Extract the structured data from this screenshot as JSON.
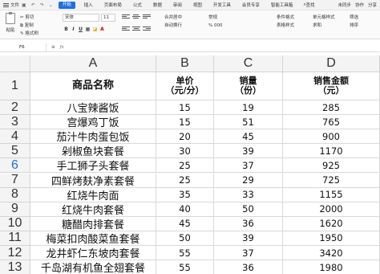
{
  "menubar": {
    "file": "文件",
    "tabs": [
      "开始",
      "插入",
      "页面布局",
      "公式",
      "数据",
      "审阅",
      "视图",
      "开发工具",
      "会员专享",
      "智能工具箱"
    ],
    "active_tab": 0,
    "search": "查找",
    "right_items": [
      "未同步",
      "协作",
      "分享"
    ]
  },
  "ribbon": {
    "paste": "粘贴",
    "cut": "剪切",
    "copy": "复制",
    "format_painter": "格式刷",
    "font": "宋体",
    "size": "11",
    "bold": "B",
    "italic": "I",
    "underline": "U",
    "wrap": "合并居中",
    "autowrap": "自动换行",
    "number_format": "常规",
    "percent": "% 000",
    "cond_fmt": "条件格式",
    "table_style": "表格样式",
    "cell_style": "单元格样式",
    "sum": "求和",
    "filter": "筛选",
    "sort": "排序"
  },
  "formula_bar": {
    "name_box": "F6",
    "fx": "fx",
    "value": ""
  },
  "sheet": {
    "columns": [
      "A",
      "B",
      "C",
      "D"
    ],
    "row_numbers": [
      "1",
      "2",
      "3",
      "4",
      "5",
      "6",
      "7",
      "8",
      "9",
      "10",
      "11",
      "12",
      "13"
    ],
    "selected_row": "6",
    "header_row": {
      "a": "商品名称",
      "b1": "单价",
      "b2": "（元/分）",
      "c1": "销量",
      "c2": "（份）",
      "d1": "销售金额",
      "d2": "（元）"
    },
    "rows": [
      {
        "name": "八宝辣酱饭",
        "price": "15",
        "qty": "19",
        "amount": "285"
      },
      {
        "name": "宫爆鸡丁饭",
        "price": "15",
        "qty": "51",
        "amount": "765"
      },
      {
        "name": "茄汁牛肉蛋包饭",
        "price": "20",
        "qty": "45",
        "amount": "900"
      },
      {
        "name": "剁椒鱼块套餐",
        "price": "30",
        "qty": "39",
        "amount": "1170"
      },
      {
        "name": "手工狮子头套餐",
        "price": "25",
        "qty": "37",
        "amount": "925"
      },
      {
        "name": "四鲜烤麸净素套餐",
        "price": "25",
        "qty": "29",
        "amount": "725"
      },
      {
        "name": "红烧牛肉面",
        "price": "35",
        "qty": "33",
        "amount": "1155"
      },
      {
        "name": "红烧牛肉套餐",
        "price": "40",
        "qty": "50",
        "amount": "2000"
      },
      {
        "name": "糖醋肉排套餐",
        "price": "45",
        "qty": "36",
        "amount": "1620"
      },
      {
        "name": "梅菜扣肉酸菜鱼套餐",
        "price": "50",
        "qty": "39",
        "amount": "1950"
      },
      {
        "name": "龙井虾仁东坡肉套餐",
        "price": "55",
        "qty": "37",
        "amount": "3420"
      },
      {
        "name": "千岛湖有机鱼全翅套餐",
        "price": "55",
        "qty": "36",
        "amount": "1980"
      }
    ]
  }
}
